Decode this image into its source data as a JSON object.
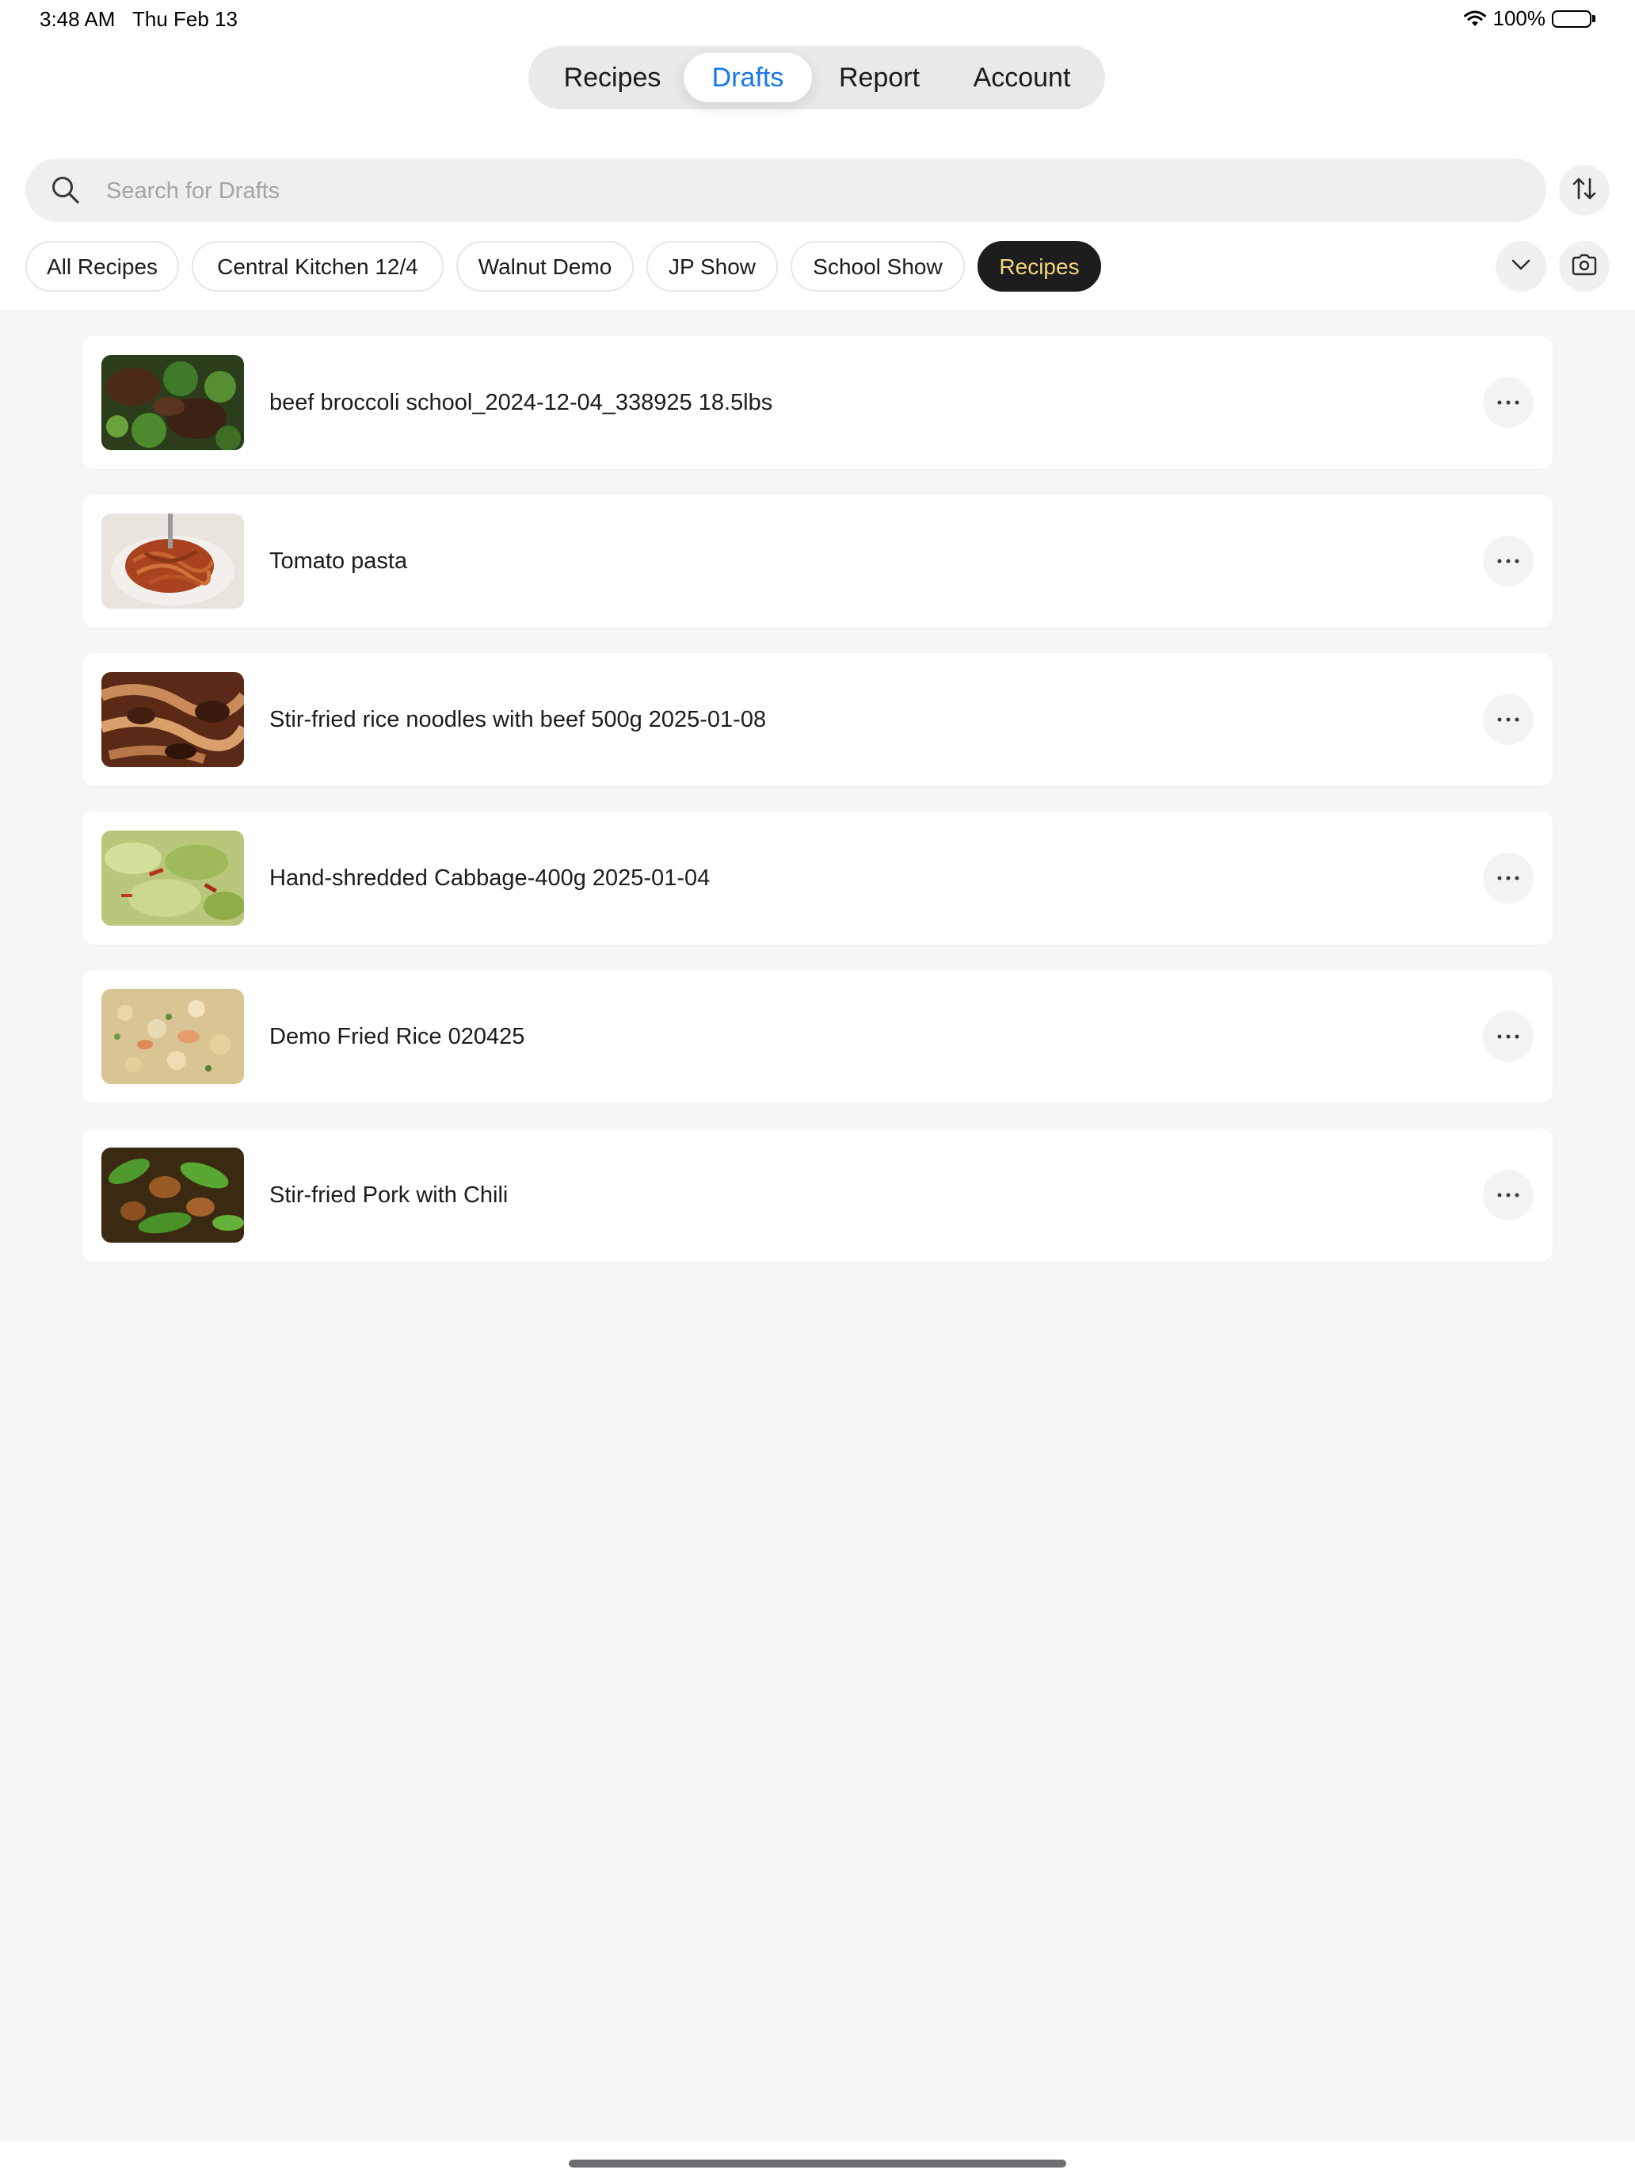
{
  "status_bar": {
    "time": "3:48 AM",
    "date": "Thu Feb 13",
    "battery": "100%",
    "battery_level": 1.0
  },
  "tabs": [
    {
      "label": "Recipes",
      "active": false
    },
    {
      "label": "Drafts",
      "active": true
    },
    {
      "label": "Report",
      "active": false
    },
    {
      "label": "Account",
      "active": false
    }
  ],
  "search": {
    "placeholder": "Search for Drafts",
    "value": ""
  },
  "filters": [
    {
      "label": "All Recipes",
      "selected": false
    },
    {
      "label": "Central Kitchen 12/4",
      "selected": false
    },
    {
      "label": "Walnut Demo",
      "selected": false
    },
    {
      "label": "JP Show",
      "selected": false
    },
    {
      "label": "School Show",
      "selected": false
    },
    {
      "label": "Recipes",
      "selected": true
    }
  ],
  "icons": {
    "sort": "sort-icon",
    "expand": "chevron-down-icon",
    "camera": "camera-icon",
    "more": "more-icon"
  },
  "drafts": [
    {
      "title": "beef broccoli school_2024-12-04_338925 18.5lbs",
      "thumbnail": "beef-broccoli-photo"
    },
    {
      "title": "Tomato pasta",
      "thumbnail": "tomato-pasta-photo"
    },
    {
      "title": "Stir-fried rice noodles with beef 500g 2025-01-08",
      "thumbnail": "rice-noodles-photo"
    },
    {
      "title": "Hand-shredded Cabbage-400g 2025-01-04",
      "thumbnail": "cabbage-photo"
    },
    {
      "title": "Demo Fried Rice 020425",
      "thumbnail": "fried-rice-photo"
    },
    {
      "title": "Stir-fried Pork with Chili",
      "thumbnail": "pork-chili-photo"
    }
  ],
  "colors": {
    "accent": "#1877e8",
    "selected_chip_bg": "#1d1d1f",
    "selected_chip_text": "#f3d77a",
    "background": "#f6f6f6"
  }
}
